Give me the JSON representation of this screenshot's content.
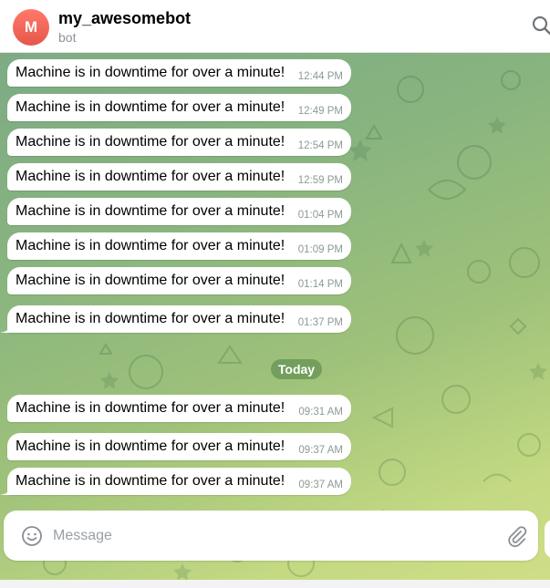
{
  "header": {
    "avatar_letter": "M",
    "title": "my_awesomebot",
    "subtitle": "bot",
    "avatar_color": "#e5574a"
  },
  "messages_before": [
    {
      "text": "Machine is in downtime for over a minute!",
      "time": "12:44 PM"
    },
    {
      "text": "Machine is in downtime for over a minute!",
      "time": "12:49 PM"
    },
    {
      "text": "Machine is in downtime for over a minute!",
      "time": "12:54 PM"
    },
    {
      "text": "Machine is in downtime for over a minute!",
      "time": "12:59 PM"
    },
    {
      "text": "Machine is in downtime for over a minute!",
      "time": "01:04 PM"
    },
    {
      "text": "Machine is in downtime for over a minute!",
      "time": "01:09 PM"
    },
    {
      "text": "Machine is in downtime for over a minute!",
      "time": "01:14 PM"
    },
    {
      "text": "Machine is in downtime for over a minute!",
      "time": "01:37 PM"
    }
  ],
  "date_separator": "Today",
  "messages_after": [
    {
      "text": "Machine is in downtime for over a minute!",
      "time": "09:31 AM"
    },
    {
      "text": "Machine is in downtime for over a minute!",
      "time": "09:37 AM"
    },
    {
      "text": "Machine is in downtime for over a minute!",
      "time": "09:37 AM"
    }
  ],
  "composer": {
    "placeholder": "Message",
    "emoji_icon": "smile-icon",
    "attach_icon": "paperclip-icon"
  },
  "colors": {
    "chat_bg_start": "#7dab84",
    "chat_bg_end": "#cfde86",
    "bubble": "#ffffff",
    "time_text": "#8c9a96"
  }
}
